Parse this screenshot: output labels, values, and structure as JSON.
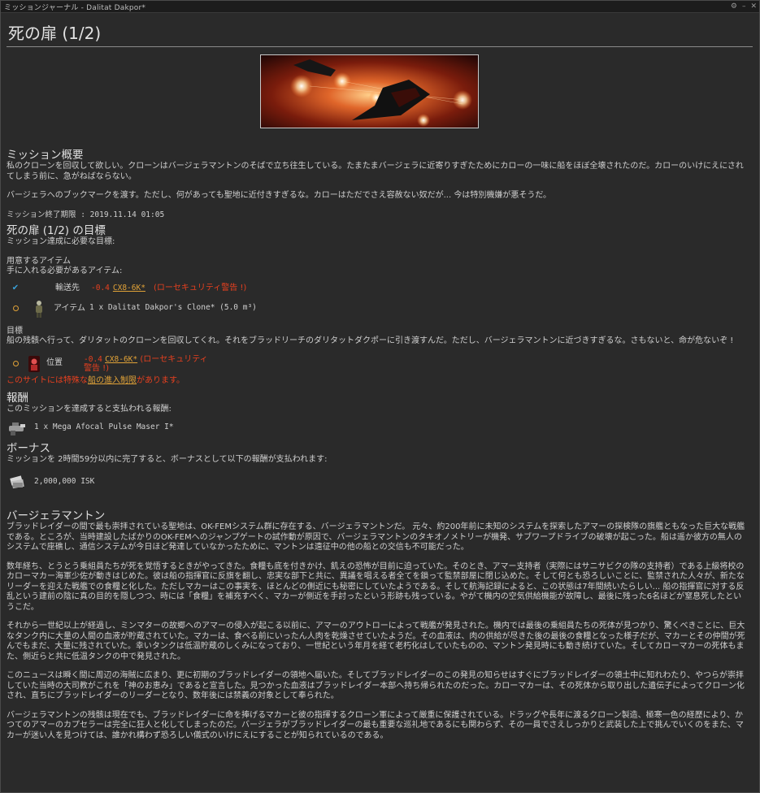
{
  "window": {
    "title": "ミッションジャーナル - Dalitat Dakpor*",
    "controls": [
      "gear-icon",
      "minimize-icon",
      "close-icon"
    ]
  },
  "page": {
    "title": "死の扉 (1/2)"
  },
  "overview": {
    "heading": "ミッション概要",
    "p1": "私のクローンを回収して欲しい。クローンはバージェラマントンのそばで立ち往生している。たまたまバージェラに近寄りすぎたためにカローの一味に船をほぼ全壊されたのだ。カローのいけにえにされてしまう前に、急がねばならない。",
    "p2": "バージェラへのブックマークを渡す。ただし、何があっても聖地に近付きすぎるな。カローはただでさえ容赦ない奴だが... 今は特別機嫌が悪そうだ。",
    "deadline": "ミッション終了期限 : 2019.11.14 01:05"
  },
  "objectives": {
    "heading": "死の扉 (1/2) の目標",
    "sub": "ミッション達成に必要な目標:",
    "items_heading": "用意するアイテム",
    "items_sub": "手に入れる必要があるアイテム:",
    "dest_label": "輸送先",
    "dest_sec": "-0.4",
    "dest_system": "CX8-6K*",
    "dest_warning": "(ローセキュリティ警告 !)",
    "item_label": "アイテム",
    "item_text": "1 x Dalitat Dakpor's Clone* (5.0 m³)",
    "goal_heading": "目標",
    "goal_text": "船の残骸へ行って、ダリタットのクローンを回収してくれ。それをブラッドリーチのダリタットダクポーに引き渡すんだ。ただし、バージェラマントンに近づきすぎるな。さもないと、命が危ないぞ !",
    "loc_label": "位置",
    "loc_sec": "-0.4",
    "loc_system": "CX8-6K*",
    "loc_warning": "(ローセキュリティ警告 !)",
    "restrict_pre": "このサイトには特殊な",
    "restrict_link": "船の進入制限",
    "restrict_post": "があります。"
  },
  "reward": {
    "heading": "報酬",
    "sub": "このミッションを達成すると支払われる報酬:",
    "item": "1 x Mega Afocal Pulse Maser I*"
  },
  "bonus": {
    "heading": "ボーナス",
    "sub": "ミッションを 2時間59分以内に完了すると、ボーナスとして以下の報酬が支払われます:",
    "item": "2,000,000 ISK"
  },
  "lore": {
    "heading": "バージェラマントン",
    "p1": "ブラッドレイダーの間で最も崇拝されている聖地は、OK-FEMシステム群に存在する、バージェラマントンだ。 元々、約200年前に未知のシステムを探索したアマーの探検隊の旗艦ともなった巨大な戦艦である。ところが、当時建設したばかりのOK-FEMへのジャンプゲートの試作動が原因で、バージェラマントンのタキオノメトリーが機発、サブワープドライブの破壊が起こった。船は遥か彼方の無人のシステムで座礁し、通信システムが今日ほど発達していなかったために、マントンは遠征中の他の船との交信も不可能だった。",
    "p2": "数年経ち、とうとう乗組員たちが死を覚悟するときがやってきた。食糧も底を付きかけ、飢えの恐怖が目前に迫っていた。そのとき、アマー支持者（実際にはサニサビクの隊の支持者）である上級将校のカローマカー海軍少佐が動きはじめた。彼は船の指揮官に反旗を翻し、忠実な部下と共に、異議を唱える者全てを鎖って監禁部屋に閉じ込めた。そして何とも恐ろしいことに、監禁された人々が、新たなリーダーを迎えた戦艦での食糧と化した。ただしマカーはこの事実を、ほとんどの側近にも秘密にしていたようである。そして航海記録によると、この状態は7年間続いたらしい... 船の指揮官に対する反乱という建前の陰に真の目的を隠しつつ、時には「食糧」を補充すべく、マカーが側近を手討ったという形跡も残っている。やがて機内の空気供給機能が故障し、最後に残った6名ほどが窒息死したというこだ。",
    "p3": "それから一世紀以上が経過し、ミンマターの故郷へのアマーの侵入が起こる以前に、アマーのアウトローによって戦艦が発見された。機内では最後の乗組員たちの死体が見つかり、驚くべきことに、巨大なタンク内に大量の人間の血液が貯蔵されていた。マカーは、食べる前にいったん人肉を乾燥させていたようだ。その血液は、肉の供給が尽きた後の最後の食糧となった様子だが、マカーとその仲間が死んでもまだ、大量に残されていた。幸いタンクは低温貯蔵のしくみになっており、一世紀という年月を経て老朽化はしていたものの、マントン発見時にも動き続けていた。そしてカローマカーの死体もまた、側近らと共に低温タンクの中で発見された。",
    "p4": "このニュースは瞬く間に周辺の海賊に広まり、更に初期のブラッドレイダーの領地へ届いた。そしてブラッドレイダーのこの発見の知らせはすぐにブラッドレイダーの領土中に知れわたり、やつらが崇拝していた当時の大司教がこれを「神のお恵み」であると宣言した。見つかった血液はブラッドレイダー本部へ持ち帰られたのだった。カローマカーは、その死体から取り出した遺伝子によってクローン化され、直ちにブラッドレイダーのリーダーとなり、数年後には禁義の対象として奉られた。",
    "p5": "バージェラマントンの残骸は現在でも、ブラッドレイダーに命を捧げるマカーと彼の指揮するクローン軍によって厳重に保護されている。ドラッグや長年に渡るクローン製造、極寒一色の経歴により、かつてのアマーのカプセラーは完全に狂人と化してしまったのだ。バージェラがブラッドレイダーの最も重要な巡礼地であるにも関わらず、その一員でさえしっかりと武装した上で挑んでいくのをまた、マカーが迷い人を見つけては、誰かれ構わず恐ろしい儀式のいけにえにすることが知られているのである。"
  },
  "colors": {
    "warning": "#e8401f",
    "link": "#e0a238",
    "check": "#3aa0d8"
  }
}
